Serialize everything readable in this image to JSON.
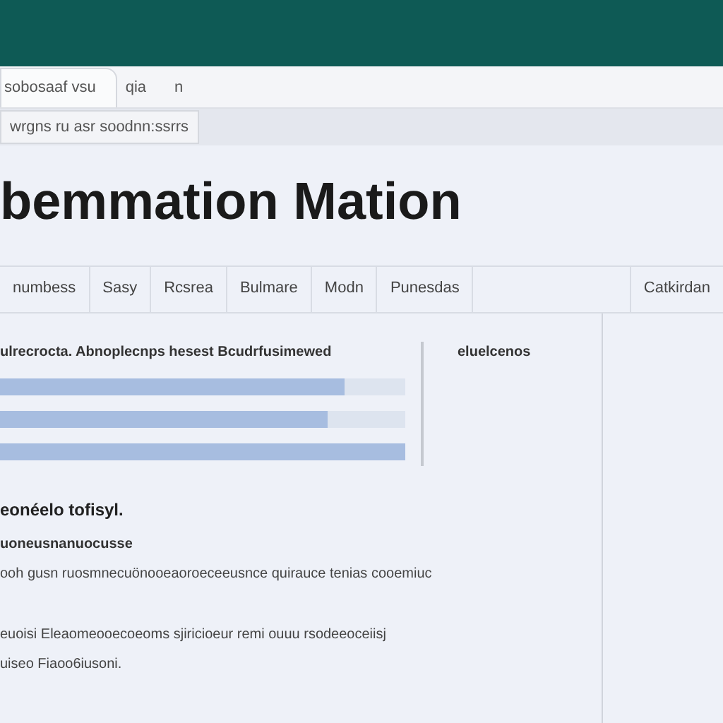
{
  "browser_tabs": [
    {
      "label": "sobosaaf vsu",
      "selected": true
    },
    {
      "label": "qia",
      "selected": false
    },
    {
      "label": "n",
      "selected": false
    }
  ],
  "address": "wrgns ru asr soodnn:ssrrs",
  "heading": "bemmation Mation",
  "tabs": [
    {
      "label": "numbess",
      "selected": false
    },
    {
      "label": "Sasy",
      "selected": false
    },
    {
      "label": "Rcsrea",
      "selected": false
    },
    {
      "label": "Bulmare",
      "selected": false
    },
    {
      "label": "Modn",
      "selected": false
    },
    {
      "label": "Punesdas",
      "selected": false
    },
    {
      "label": "Catkirdan",
      "selected": false
    }
  ],
  "panel": {
    "title": "ulrecrocta. Abnoplecnps hesest Bcudrfusimewed",
    "bars": [
      {
        "level": 0.85
      },
      {
        "level": 0.81
      },
      {
        "level": 1.0
      }
    ],
    "side_label": "eluelcenos"
  },
  "body": [
    {
      "kind": "heading",
      "text": "eonéelo tofisyl."
    },
    {
      "kind": "subheading",
      "text": "uoneusnanuocusse"
    },
    {
      "kind": "text",
      "text": "ooh gusn ruosmnecuönooeaoroeceeusnce quirauce tenias cooemiuc"
    },
    {
      "kind": "gap"
    },
    {
      "kind": "text",
      "text": "euoisi  Eleaomeooecoeoms sjiricioeur remi ouuu  rsodeeoceiisj"
    },
    {
      "kind": "text",
      "text": "uiseo Fiaoo6iusoni."
    }
  ]
}
